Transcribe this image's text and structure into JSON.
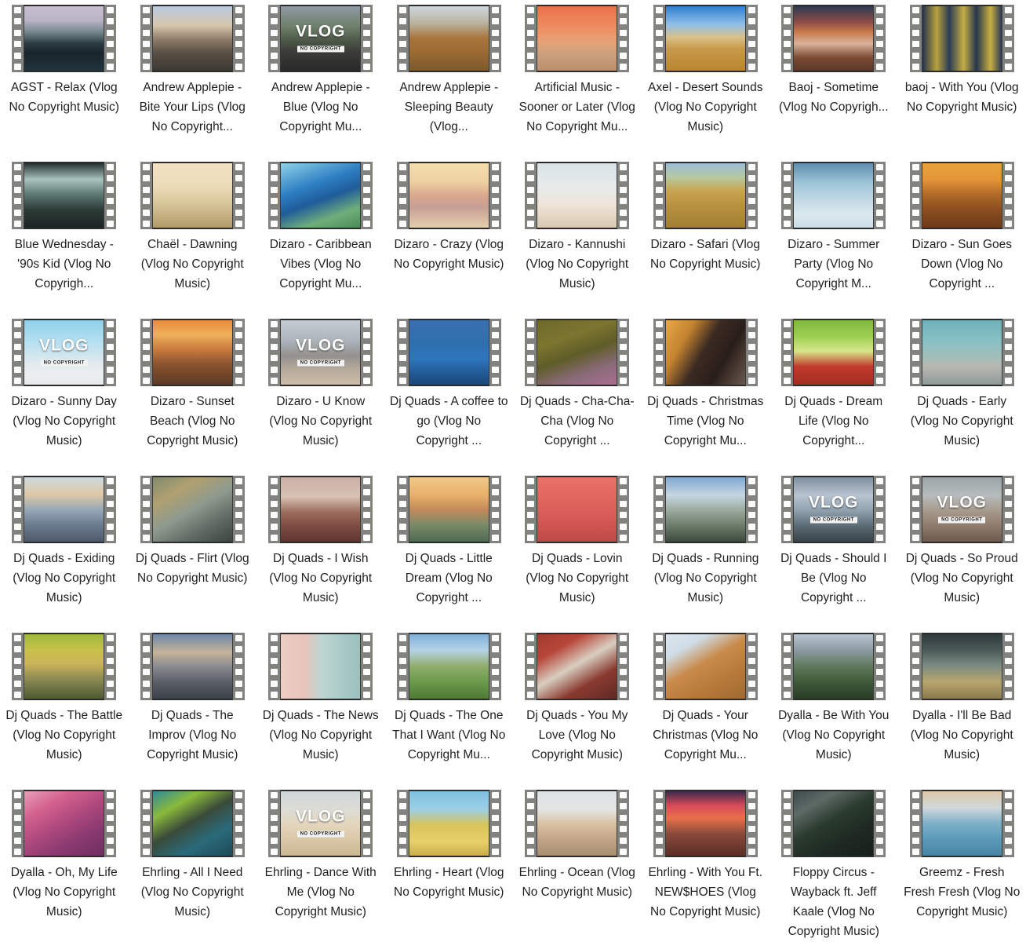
{
  "window": {
    "view_mode": "medium-icons-grid",
    "columns": 8,
    "rows_visible": 6,
    "background_color": "#ffffff",
    "label_color": "#1f1f1f",
    "film_strip_color": "#82827f",
    "sprocket_color": "#fdfdfd"
  },
  "icons": {
    "film_strip": "film-strip-icon",
    "vlog_overlay": "vlog-no-copyright-badge"
  },
  "badge": {
    "word": "VLOG",
    "sub": "NO COPYRIGHT"
  },
  "files": [
    {
      "label": "AGST - Relax (Vlog No Copyright Music)",
      "thumb": "linear-gradient(180deg,#c9bed2 0%,#b9b4c6 22%,#6e7f86 42%,#2b3b42 58%,#18242b 72%,#22333c 100%)",
      "vlog": false
    },
    {
      "label": "Andrew Applepie - Bite Your Lips (Vlog No Copyright...",
      "thumb": "linear-gradient(180deg,#b8cbe0 0%,#d7c6ad 30%,#8d7a68 52%,#5a5044 72%,#3c3832 100%)",
      "vlog": false
    },
    {
      "label": "Andrew Applepie - Blue (Vlog No Copyright Mu...",
      "thumb": "linear-gradient(180deg,#8f9aa3 0%,#6e7f6a 32%,#4e5a4a 52%,#3a3a38 72%,#2a2a2a 100%)",
      "vlog": true
    },
    {
      "label": "Andrew Applepie - Sleeping Beauty (Vlog...",
      "thumb": "linear-gradient(180deg,#cfd8dd 0%,#b9b3a0 26%,#a8743b 50%,#9c6b33 70%,#7c5a2c 100%)",
      "vlog": false
    },
    {
      "label": "Artificial Music - Sooner or Later (Vlog No Copyright Mu...",
      "thumb": "linear-gradient(180deg,#e8714a 0%,#ef8a5e 30%,#e8a278 55%,#caa07c 75%,#b99070 100%)",
      "vlog": false
    },
    {
      "label": "Axel - Desert Sounds (Vlog No Copyright Music)",
      "thumb": "linear-gradient(180deg,#2f7fd0 0%,#8fc0e8 28%,#d8c08a 48%,#c79a4c 66%,#b9862f 100%)",
      "vlog": false
    },
    {
      "label": "Baoj - Sometime (Vlog No Copyrigh...",
      "thumb": "linear-gradient(180deg,#2e3a52 0%,#8b4a46 24%,#c87a4a 40%,#d9b29a 58%,#7a4a33 80%,#5c3828 100%)",
      "vlog": false
    },
    {
      "label": "baoj - With You (Vlog No Copyright Music)",
      "thumb": "linear-gradient(90deg,#23324d 0%,#b8a23e 18%,#2b3a55 34%,#c5ae45 52%,#27364f 68%,#c9ad42 86%,#2b3a52 100%)",
      "vlog": false
    },
    {
      "label": "Blue Wednesday - '90s Kid (Vlog No Copyrigh...",
      "thumb": "linear-gradient(180deg,#24332f 0%,#a9c2bb 25%,#5e7a72 48%,#2d3b37 72%,#1b2523 100%)",
      "vlog": false
    },
    {
      "label": "Chaël - Dawning (Vlog No Copyright Music)",
      "thumb": "linear-gradient(180deg,#f2e2c3 0%,#eddcb8 35%,#d9c89d 60%,#c2ab7c 85%,#b29a6c 100%)",
      "vlog": false
    },
    {
      "label": "Dizaro - Caribbean Vibes (Vlog No Copyright Mu...",
      "thumb": "linear-gradient(160deg,#8fd3e8 0%,#2f7fc4 35%,#1f5c9a 55%,#6fae7a 78%,#4c8a58 100%)",
      "vlog": false
    },
    {
      "label": "Dizaro - Crazy (Vlog No Copyright Music)",
      "thumb": "linear-gradient(180deg,#f3dfae 0%,#edcfa0 30%,#d9a88f 50%,#c79f95 68%,#e4cfae 100%)",
      "vlog": false
    },
    {
      "label": "Dizaro - Kannushi (Vlog No Copyright Music)",
      "thumb": "linear-gradient(180deg,#d9e3e8 0%,#e6eaea 35%,#efe6da 62%,#e3d5c2 85%,#d8c9b4 100%)",
      "vlog": false
    },
    {
      "label": "Dizaro - Safari (Vlog No Copyright Music)",
      "thumb": "linear-gradient(180deg,#9dbcd6 0%,#b6c9a0 22%,#c9a552 42%,#b8913f 66%,#a07f33 100%)",
      "vlog": false
    },
    {
      "label": "Dizaro - Summer Party (Vlog No Copyright M...",
      "thumb": "linear-gradient(180deg,#5e8fae 0%,#9dc3d6 30%,#c3dae6 58%,#dce9ef 80%,#cbdde6 100%)",
      "vlog": false
    },
    {
      "label": "Dizaro - Sun Goes Down (Vlog No Copyright ...",
      "thumb": "linear-gradient(180deg,#e8a33a 0%,#e5943a 26%,#b06a28 48%,#8e4f21 70%,#6d3b1a 100%)",
      "vlog": false
    },
    {
      "label": "Dizaro - Sunny Day (Vlog No Copyright Music)",
      "thumb": "linear-gradient(180deg,#8fd0ea 0%,#b7e0f0 35%,#dfe9ee 65%,#eceff0 85%,#e6e9ea 100%)",
      "vlog": true
    },
    {
      "label": "Dizaro - Sunset Beach (Vlog No Copyright Music)",
      "thumb": "linear-gradient(180deg,#e88c3a 0%,#f0b05a 22%,#c97c3e 45%,#8a5330 68%,#5c3a26 100%)",
      "vlog": false
    },
    {
      "label": "Dizaro - U Know (Vlog No Copyright Music)",
      "thumb": "linear-gradient(180deg,#c3cbd2 0%,#aeb6bd 30%,#93918d 55%,#b9ab9c 78%,#cbbda9 100%)",
      "vlog": true
    },
    {
      "label": "Dj Quads - A coffee to go (Vlog No Copyright ...",
      "thumb": "linear-gradient(180deg,#3a6fb0 0%,#2f6fae 35%,#2d76bc 60%,#225a96 82%,#1b4876 100%)",
      "vlog": false
    },
    {
      "label": "Dj Quads - Cha-Cha-Cha (Vlog No Copyright ...",
      "thumb": "linear-gradient(160deg,#6e6a2a 0%,#7d7530 30%,#5e5c28 52%,#8a6a78 76%,#a86f90 100%)",
      "vlog": false
    },
    {
      "label": "Dj Quads - Christmas Time (Vlog No Copyright Mu...",
      "thumb": "linear-gradient(120deg,#e8a846 0%,#c4832f 25%,#3a2a22 48%,#2a1e1a 70%,#6b5a4e 100%)",
      "vlog": false
    },
    {
      "label": "Dj Quads - Dream Life (Vlog No Copyright...",
      "thumb": "linear-gradient(180deg,#7fb83c 0%,#9bcf52 25%,#d8e68a 48%,#c03a2a 72%,#a32e22 100%)",
      "vlog": false
    },
    {
      "label": "Dj Quads - Early (Vlog No Copyright Music)",
      "thumb": "linear-gradient(180deg,#6fb0b8 0%,#86c0c4 30%,#9dbfbc 52%,#b8b8b2 72%,#8f9a96 100%)",
      "vlog": false
    },
    {
      "label": "Dj Quads - Exiding (Vlog No Copyright Music)",
      "thumb": "linear-gradient(180deg,#cdd9df 0%,#dfc9a8 26%,#9aa8b6 50%,#6d7f92 72%,#4e5a68 100%)",
      "vlog": false
    },
    {
      "label": "Dj Quads - Flirt (Vlog No Copyright Music)",
      "thumb": "linear-gradient(150deg,#7f8a6e 0%,#b0a070 25%,#8e9a8e 50%,#5e6a62 75%,#3c4440 100%)",
      "vlog": false
    },
    {
      "label": "Dj Quads - I Wish (Vlog No Copyright Music)",
      "thumb": "linear-gradient(180deg,#c9b0a6 0%,#d8c2b2 30%,#9a6a5c 55%,#7a4a40 78%,#5e3630 100%)",
      "vlog": false
    },
    {
      "label": "Dj Quads - Little Dream (Vlog No Copyright ...",
      "thumb": "linear-gradient(180deg,#f0c98a 0%,#e8b06a 28%,#c48a5a 50%,#7a8a6a 74%,#4e6a52 100%)",
      "vlog": false
    },
    {
      "label": "Dj Quads - Lovin (Vlog No Copyright Music)",
      "thumb": "linear-gradient(180deg,#e8726a 0%,#e0655e 35%,#d75a56 62%,#c8504c 85%,#bc4a48 100%)",
      "vlog": false
    },
    {
      "label": "Dj Quads - Running (Vlog No Copyright Music)",
      "thumb": "linear-gradient(180deg,#7fa8cf 0%,#c6d6e2 28%,#9aa89c 52%,#6a7a68 76%,#3e4a3e 100%)",
      "vlog": false
    },
    {
      "label": "Dj Quads - Should I Be (Vlog No Copyright ...",
      "thumb": "linear-gradient(180deg,#7f8ea0 0%,#b8c4cf 28%,#8fa0ae 52%,#5a6a72 76%,#39434a 100%)",
      "vlog": true
    },
    {
      "label": "Dj Quads - So Proud (Vlog No Copyright Music)",
      "thumb": "linear-gradient(180deg,#9aa4a8 0%,#b6bcbc 28%,#a89a8e 52%,#8e7a6a 76%,#6e5a4e 100%)",
      "vlog": true
    },
    {
      "label": "Dj Quads - The Battle (Vlog No Copyright Music)",
      "thumb": "linear-gradient(180deg,#9fb83c 0%,#c8c24a 24%,#cbb35a 46%,#8a8a52 70%,#4e5a34 100%)",
      "vlog": false
    },
    {
      "label": "Dj Quads - The Improv (Vlog No Copyright Music)",
      "thumb": "linear-gradient(180deg,#6f86a8 0%,#c4b49a 28%,#8a8a90 50%,#5a5f68 74%,#3c4048 100%)",
      "vlog": false
    },
    {
      "label": "Dj Quads - The News (Vlog No Copyright Music)",
      "thumb": "linear-gradient(90deg,#eccdc4 0%,#e8c4ba 30%,#bcd6d2 52%,#a8cac6 78%,#9cc0bc 100%)",
      "vlog": false
    },
    {
      "label": "Dj Quads - The One That I Want (Vlog No Copyright Mu...",
      "thumb": "linear-gradient(180deg,#7fb0d8 0%,#b6d2e6 25%,#8fae6a 50%,#6a9a4a 74%,#4e7a36 100%)",
      "vlog": false
    },
    {
      "label": "Dj Quads - You My Love (Vlog No Copyright Music)",
      "thumb": "linear-gradient(150deg,#a03a2e 0%,#b8463a 24%,#d8cec0 48%,#8a3a30 72%,#5e2a24 100%)",
      "vlog": false
    },
    {
      "label": "Dj Quads - Your Christmas (Vlog No Copyright Mu...",
      "thumb": "linear-gradient(150deg,#dde6ee 0%,#cfdce6 22%,#c98a4a 46%,#b87a3a 70%,#a06a32 100%)",
      "vlog": false
    },
    {
      "label": "Dyalla - Be With You (Vlog No Copyright Music)",
      "thumb": "linear-gradient(180deg,#b9c6cf 0%,#8c9aa4 25%,#5e7a5a 50%,#3e5a38 74%,#2a3e26 100%)",
      "vlog": false
    },
    {
      "label": "Dyalla - I'll Be Bad (Vlog No Copyright Music)",
      "thumb": "linear-gradient(180deg,#2e3a3c 0%,#4c5a58 25%,#7a8a82 48%,#b8a66e 74%,#8a7a4e 100%)",
      "vlog": false
    },
    {
      "label": "Dyalla - Oh, My Life (Vlog No Copyright Music)",
      "thumb": "linear-gradient(150deg,#e8a0b8 0%,#d4628e 25%,#b04a7e 48%,#8a3a70 72%,#6e2e5e 100%)",
      "vlog": false
    },
    {
      "label": "Ehrling - All I Need (Vlog No Copyright Music)",
      "thumb": "linear-gradient(150deg,#2e8a9a 0%,#8aba3a 25%,#3a4a3a 48%,#2a6a7a 72%,#1e4a58 100%)",
      "vlog": false
    },
    {
      "label": "Ehrling - Dance With Me (Vlog No Copyright Music)",
      "thumb": "linear-gradient(180deg,#cfd6d8 0%,#dcdcd6 28%,#e4d6bc 52%,#d8c5a4 78%,#cbb794 100%)",
      "vlog": true
    },
    {
      "label": "Ehrling - Heart (Vlog No Copyright Music)",
      "thumb": "linear-gradient(180deg,#7fc0e0 0%,#9ccfe6 28%,#d8c45a 52%,#e8d06a 78%,#c9ae4a 100%)",
      "vlog": false
    },
    {
      "label": "Ehrling - Ocean (Vlog No Copyright Music)",
      "thumb": "linear-gradient(180deg,#dde2e4 0%,#e4e6e4 28%,#d8c0a0 52%,#bfa285 78%,#a88e72 100%)",
      "vlog": false
    },
    {
      "label": "Ehrling - With You Ft. NEW$HOES (Vlog No Copyright Music)",
      "thumb": "linear-gradient(180deg,#3a2a4a 0%,#d84a5a 22%,#e8704a 42%,#8a4a3a 66%,#5a2e26 100%)",
      "vlog": false
    },
    {
      "label": "Floppy Circus - Wayback ft. Jeff Kaale (Vlog No Copyright Music)",
      "thumb": "linear-gradient(150deg,#3e4a4a 0%,#5e6a66 22%,#2a3a2e 46%,#1e2a22 70%,#16201a 100%)",
      "vlog": false
    },
    {
      "label": "Greemz - Fresh Fresh Fresh (Vlog No Copyright Music)",
      "thumb": "linear-gradient(180deg,#e0c8a8 0%,#cfd8dc 26%,#7fb0c8 50%,#5a9ab8 74%,#4a86a4 100%)",
      "vlog": false
    }
  ]
}
